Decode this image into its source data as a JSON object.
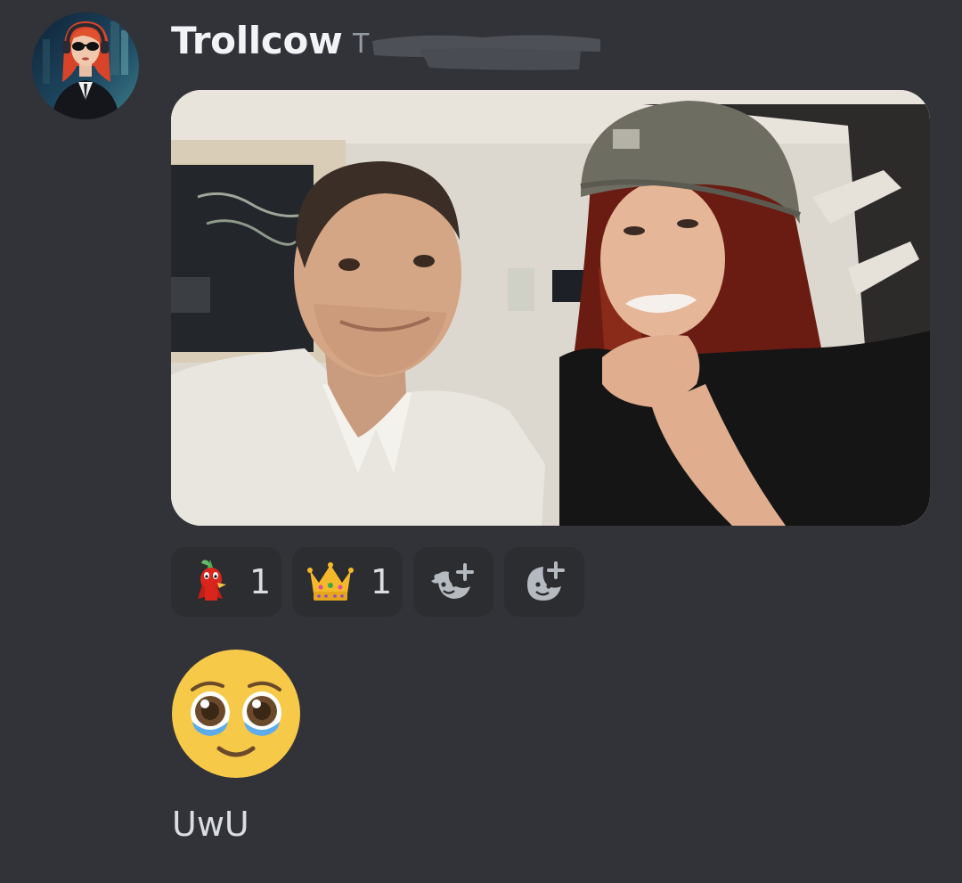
{
  "message": {
    "author": "Trollcow",
    "timestamp_visible": "T",
    "avatar_icon": "avatar-woman-red-hair-sunglasses",
    "attachment_icon": "photo-two-people",
    "reactions": [
      {
        "emoji": "red-pikmin-icon",
        "count": "1"
      },
      {
        "emoji": "crown-icon",
        "count": "1"
      },
      {
        "emoji": "add-super-reaction-icon"
      },
      {
        "emoji": "add-reaction-icon"
      }
    ],
    "big_emoji": "pleading-face-icon",
    "text": "UwU"
  },
  "colors": {
    "background": "#313338",
    "reaction_bg": "#2b2d31",
    "username": "#f2f3f5",
    "muted": "#949ba4",
    "text": "#dbdee1"
  }
}
